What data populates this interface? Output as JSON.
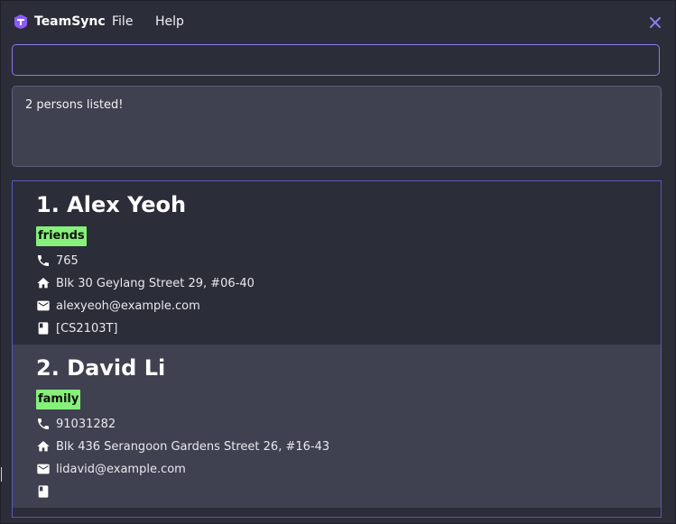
{
  "app": {
    "name": "TeamSync",
    "menu": [
      "File",
      "Help"
    ],
    "brand_color": "#8b5cf6"
  },
  "command": {
    "value": "",
    "placeholder": ""
  },
  "result": {
    "message": "2 persons listed!"
  },
  "persons": [
    {
      "index_name": "1. Alex Yeoh",
      "tag": "friends",
      "phone": "765",
      "address": "Blk 30 Geylang Street 29, #06-40",
      "email": "alexyeoh@example.com",
      "modules": "[CS2103T]"
    },
    {
      "index_name": "2. David Li",
      "tag": "family",
      "phone": "91031282",
      "address": "Blk 436 Serangoon Gardens Street 26, #16-43",
      "email": "lidavid@example.com",
      "modules": ""
    }
  ],
  "colors": {
    "background": "#2b2d38",
    "card_alt": "#3f4150",
    "accent_border": "#8b7ce8",
    "tag_bg": "#86f07a"
  },
  "icons": [
    "app-logo-icon",
    "close-icon",
    "phone-icon",
    "home-icon",
    "email-icon",
    "book-icon"
  ]
}
